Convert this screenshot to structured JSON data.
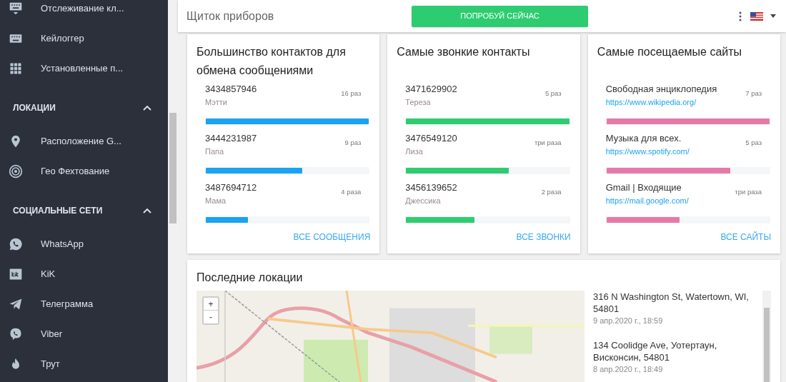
{
  "sidebar": {
    "groups": [
      {
        "items": [
          {
            "label": "Отслеживание кл..."
          },
          {
            "label": "Кейлоггер"
          },
          {
            "label": "Установленные п..."
          }
        ]
      },
      {
        "title": "ЛОКАЦИИ",
        "expanded": true,
        "items": [
          {
            "label": "Расположение G..."
          },
          {
            "label": "Гео Фехтование"
          }
        ]
      },
      {
        "title": "СОЦИАЛЬНЫЕ СЕТИ",
        "expanded": true,
        "items": [
          {
            "label": "WhatsApp"
          },
          {
            "label": "KiK"
          },
          {
            "label": "Телеграмма"
          },
          {
            "label": "Viber"
          },
          {
            "label": "Трут"
          }
        ]
      }
    ]
  },
  "header": {
    "title": "Щиток приборов",
    "cta": "ПОПРОБУЙ СЕЙЧАС"
  },
  "cards": [
    {
      "kind": "contacts",
      "title": "Большинство контактов для обмена сообщениями",
      "link": "ВСЕ СООБЩЕНИЯ",
      "rows": [
        {
          "primary": "3434857946",
          "secondary": "Мэтти",
          "count": "16 раз",
          "level": 1.0
        },
        {
          "primary": "3444231987",
          "secondary": "Папа",
          "count": "9 раз",
          "level": 0.59
        },
        {
          "primary": "3487694712",
          "secondary": "Мама",
          "count": "4 раза",
          "level": 0.26
        }
      ]
    },
    {
      "kind": "contacts",
      "title": "Самые звонкие контакты",
      "link": "ВСЕ ЗВОНКИ",
      "rows": [
        {
          "primary": "3471629902",
          "secondary": "Тереза",
          "count": "5 раз",
          "level": 1.0
        },
        {
          "primary": "3476549120",
          "secondary": "Лиза",
          "count": "три раза",
          "level": 0.63
        },
        {
          "primary": "3456139652",
          "secondary": "Джессика",
          "count": "2 раза",
          "level": 0.42
        }
      ]
    },
    {
      "kind": "sites",
      "title": "Самые посещаемые сайты",
      "link": "ВСЕ САЙТЫ",
      "rows": [
        {
          "primary": "Свободная энциклопедия",
          "secondary": "https://www.wikipedia.org/",
          "count": "7 раз",
          "level": 1.0
        },
        {
          "primary": "Музыка для всех.",
          "secondary": "https://www.spotify.com/",
          "count": "5 раз",
          "level": 0.76
        },
        {
          "primary": "Gmail | Входящие",
          "secondary": "https://mail.google.com/",
          "count": "три раза",
          "level": 0.45
        }
      ]
    }
  ],
  "locations": {
    "title": "Последние локации",
    "zoom": [
      "+",
      "-"
    ],
    "items": [
      {
        "address": "316 N Washington St, Watertown, WI, 54801",
        "date": "9 апр.2020 г., 18:59"
      },
      {
        "address": "134 Coolidge Ave, Уотертаун, Висконсин, 54801",
        "date": "8 апр.2020 г., 18:49"
      }
    ]
  }
}
